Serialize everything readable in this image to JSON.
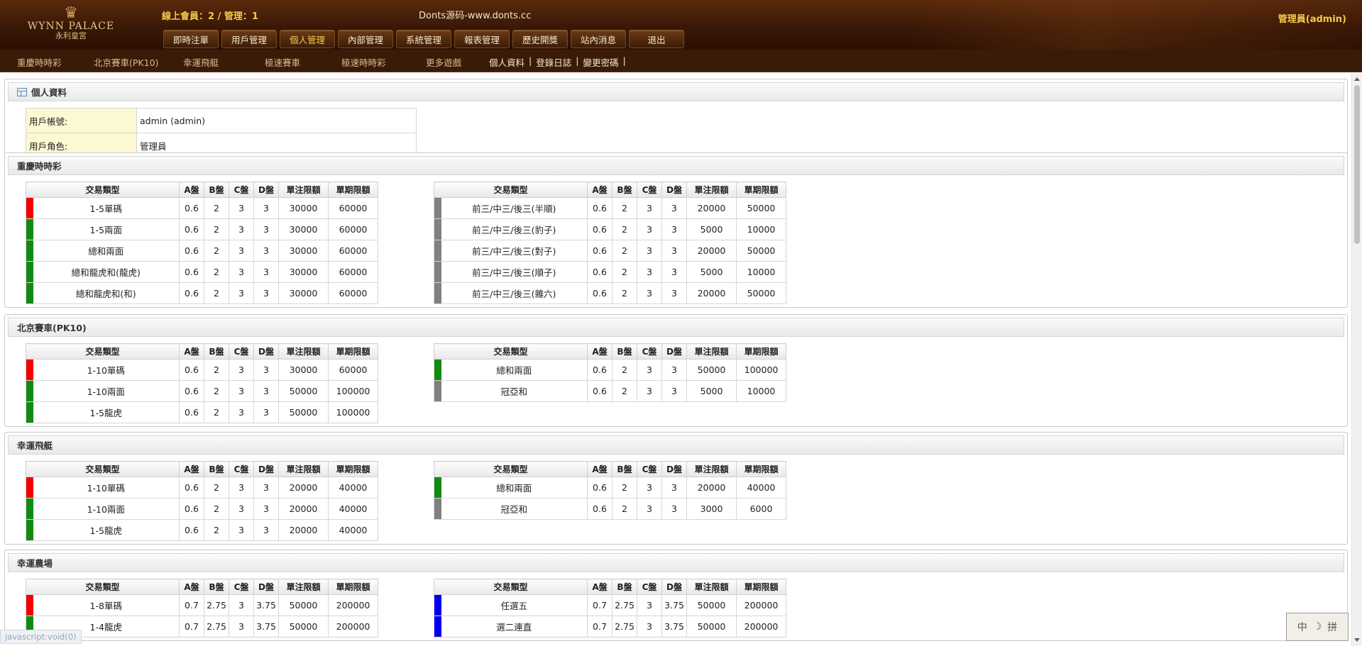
{
  "header": {
    "logo_name": "WYNN PALACE",
    "logo_sub": "永利皇宮",
    "online_text": "線上會員：2 / 管理：1",
    "site_title": "Donts源码-www.donts.cc",
    "admin_label": "管理員(admin)",
    "nav": [
      "即時注單",
      "用戶管理",
      "個人管理",
      "內部管理",
      "系統管理",
      "報表管理",
      "歷史開獎",
      "站內消息",
      "退出"
    ],
    "nav_active": "個人管理"
  },
  "subnav": {
    "games": [
      "重慶時時彩",
      "北京賽車(PK10)",
      "幸運飛艇",
      "極速賽車",
      "極速時時彩",
      "更多遊戲"
    ],
    "links": [
      "個人資料",
      "登錄日誌",
      "變更密碼"
    ]
  },
  "profile": {
    "title": "個人資料",
    "rows": [
      {
        "label": "用戶帳號:",
        "value": "admin (admin)"
      },
      {
        "label": "用戶角色:",
        "value": "管理員"
      }
    ]
  },
  "columns": [
    "交易類型",
    "A盤",
    "B盤",
    "C盤",
    "D盤",
    "單注限額",
    "單期限額"
  ],
  "colors": {
    "red": "#f40000",
    "green": "#128a12",
    "gray": "#808080",
    "blue": "#0000ee"
  },
  "sections": [
    {
      "title": "重慶時時彩",
      "left": [
        {
          "color": "red",
          "name": "1-5單碼",
          "a": "0.6",
          "b": "2",
          "c": "3",
          "d": "3",
          "single": "30000",
          "period": "60000"
        },
        {
          "color": "green",
          "name": "1-5兩面",
          "a": "0.6",
          "b": "2",
          "c": "3",
          "d": "3",
          "single": "30000",
          "period": "60000"
        },
        {
          "color": "green",
          "name": "總和兩面",
          "a": "0.6",
          "b": "2",
          "c": "3",
          "d": "3",
          "single": "30000",
          "period": "60000"
        },
        {
          "color": "green",
          "name": "總和龍虎和(龍虎)",
          "a": "0.6",
          "b": "2",
          "c": "3",
          "d": "3",
          "single": "30000",
          "period": "60000"
        },
        {
          "color": "green",
          "name": "總和龍虎和(和)",
          "a": "0.6",
          "b": "2",
          "c": "3",
          "d": "3",
          "single": "30000",
          "period": "60000"
        }
      ],
      "right": [
        {
          "color": "gray",
          "name": "前三/中三/後三(半順)",
          "a": "0.6",
          "b": "2",
          "c": "3",
          "d": "3",
          "single": "20000",
          "period": "50000"
        },
        {
          "color": "gray",
          "name": "前三/中三/後三(豹子)",
          "a": "0.6",
          "b": "2",
          "c": "3",
          "d": "3",
          "single": "5000",
          "period": "10000"
        },
        {
          "color": "gray",
          "name": "前三/中三/後三(對子)",
          "a": "0.6",
          "b": "2",
          "c": "3",
          "d": "3",
          "single": "20000",
          "period": "50000"
        },
        {
          "color": "gray",
          "name": "前三/中三/後三(順子)",
          "a": "0.6",
          "b": "2",
          "c": "3",
          "d": "3",
          "single": "5000",
          "period": "10000"
        },
        {
          "color": "gray",
          "name": "前三/中三/後三(雜六)",
          "a": "0.6",
          "b": "2",
          "c": "3",
          "d": "3",
          "single": "20000",
          "period": "50000"
        }
      ]
    },
    {
      "title": "北京賽車(PK10)",
      "left": [
        {
          "color": "red",
          "name": "1-10單碼",
          "a": "0.6",
          "b": "2",
          "c": "3",
          "d": "3",
          "single": "30000",
          "period": "60000"
        },
        {
          "color": "green",
          "name": "1-10兩面",
          "a": "0.6",
          "b": "2",
          "c": "3",
          "d": "3",
          "single": "50000",
          "period": "100000"
        },
        {
          "color": "green",
          "name": "1-5龍虎",
          "a": "0.6",
          "b": "2",
          "c": "3",
          "d": "3",
          "single": "50000",
          "period": "100000"
        }
      ],
      "right": [
        {
          "color": "green",
          "name": "總和兩面",
          "a": "0.6",
          "b": "2",
          "c": "3",
          "d": "3",
          "single": "50000",
          "period": "100000"
        },
        {
          "color": "gray",
          "name": "冠亞和",
          "a": "0.6",
          "b": "2",
          "c": "3",
          "d": "3",
          "single": "5000",
          "period": "10000"
        }
      ]
    },
    {
      "title": "幸運飛艇",
      "left": [
        {
          "color": "red",
          "name": "1-10單碼",
          "a": "0.6",
          "b": "2",
          "c": "3",
          "d": "3",
          "single": "20000",
          "period": "40000"
        },
        {
          "color": "green",
          "name": "1-10兩面",
          "a": "0.6",
          "b": "2",
          "c": "3",
          "d": "3",
          "single": "20000",
          "period": "40000"
        },
        {
          "color": "green",
          "name": "1-5龍虎",
          "a": "0.6",
          "b": "2",
          "c": "3",
          "d": "3",
          "single": "20000",
          "period": "40000"
        }
      ],
      "right": [
        {
          "color": "green",
          "name": "總和兩面",
          "a": "0.6",
          "b": "2",
          "c": "3",
          "d": "3",
          "single": "20000",
          "period": "40000"
        },
        {
          "color": "gray",
          "name": "冠亞和",
          "a": "0.6",
          "b": "2",
          "c": "3",
          "d": "3",
          "single": "3000",
          "period": "6000"
        }
      ]
    },
    {
      "title": "幸運農場",
      "left": [
        {
          "color": "red",
          "name": "1-8單碼",
          "a": "0.7",
          "b": "2.75",
          "c": "3",
          "d": "3.75",
          "single": "50000",
          "period": "200000"
        },
        {
          "color": "green",
          "name": "1-4龍虎",
          "a": "0.7",
          "b": "2.75",
          "c": "3",
          "d": "3.75",
          "single": "50000",
          "period": "200000"
        }
      ],
      "right": [
        {
          "color": "blue",
          "name": "任選五",
          "a": "0.7",
          "b": "2.75",
          "c": "3",
          "d": "3.75",
          "single": "50000",
          "period": "200000"
        },
        {
          "color": "blue",
          "name": "選二連直",
          "a": "0.7",
          "b": "2.75",
          "c": "3",
          "d": "3.75",
          "single": "50000",
          "period": "200000"
        }
      ]
    }
  ],
  "statusbar": "javascript:void(0)",
  "ime": [
    "中",
    "☽",
    "拼"
  ]
}
